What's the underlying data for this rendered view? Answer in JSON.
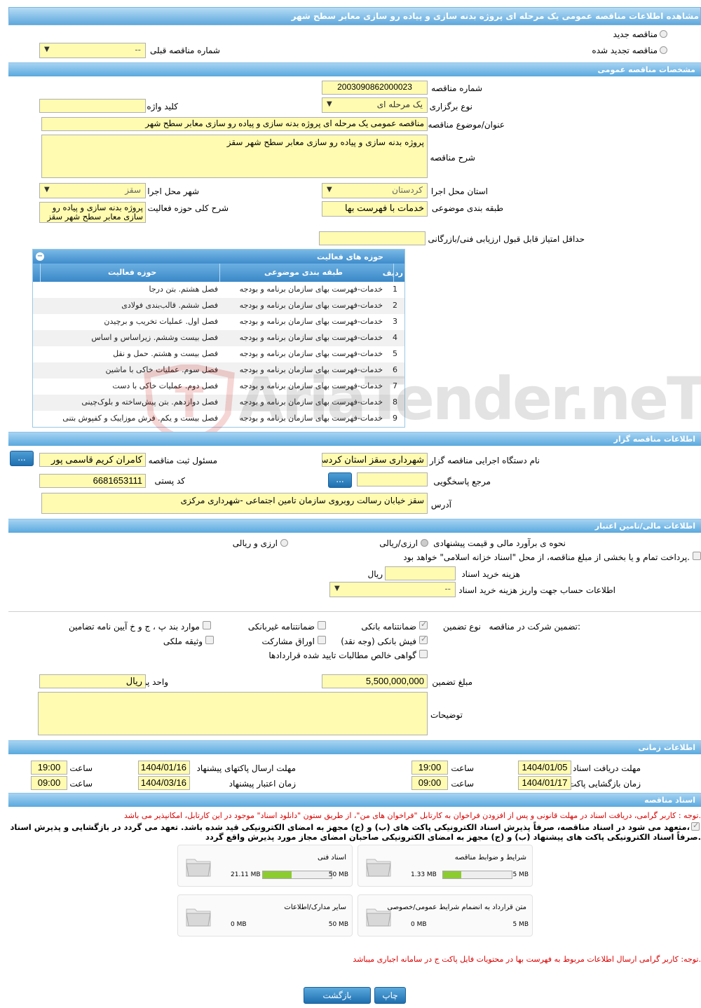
{
  "title": "مشاهده اطلاعات مناقصه عمومی یک مرحله ای پروژه بدنه سازی و پیاده رو سازی معابر سطح شهر",
  "top": {
    "new_tender": "مناقصه جدید",
    "renewed_tender": "مناقصه تجدید شده",
    "prev_number_label": "شماره مناقصه قبلی",
    "prev_number_value": "--"
  },
  "general": {
    "header": "مشخصات مناقصه عمومی",
    "number_label": "شماره مناقصه",
    "number_value": "2003090862000023",
    "type_label": "نوع برگزاری",
    "type_value": "یک مرحله ای",
    "keyword_label": "کلید واژه",
    "subject_label": "عنوان/موضوع مناقصه",
    "subject_value": "مناقصه عمومی یک مرحله ای  پروژه بدنه سازی و پیاده رو سازی معابر سطح شهر",
    "desc_label": "شرح مناقصه",
    "desc_value": "پروژه بدنه سازی و پیاده رو سازی معابر سطح شهر سقز",
    "province_label": "استان محل اجرا",
    "province_value": "کردستان",
    "city_label": "شهر محل اجرا",
    "city_value": "سقز",
    "category_label": "طبقه بندی موضوعی",
    "category_value": "خدمات با فهرست بها",
    "activity_label": "شرح کلی حوزه فعالیت",
    "activity_value": "پروژه بدنه سازی و پیاده رو سازی معابر سطح شهر سقز",
    "minscore_label": "حداقل امتیاز قابل قبول ارزیابی فنی/بازرگانی"
  },
  "activities": {
    "title": "حوزه های فعالیت",
    "col_row": "ردیف",
    "col_category": "طبقه بندی موضوعی",
    "col_activity": "حوزه فعالیت",
    "rows": [
      {
        "n": "1",
        "cat": "خدمات-فهرست بهای سازمان برنامه و بودجه",
        "act": "فصل هشتم. بتن درجا"
      },
      {
        "n": "2",
        "cat": "خدمات-فهرست بهای سازمان برنامه و بودجه",
        "act": "فصل ششم. قالب‌بندی فولادی"
      },
      {
        "n": "3",
        "cat": "خدمات-فهرست بهای سازمان برنامه و بودجه",
        "act": "فصل اول. عملیات تخریب و برچیدن"
      },
      {
        "n": "4",
        "cat": "خدمات-فهرست بهای سازمان برنامه و بودجه",
        "act": "فصل بیست وششم. زیراساس و اساس"
      },
      {
        "n": "5",
        "cat": "خدمات-فهرست بهای سازمان برنامه و بودجه",
        "act": "فصل بیست و هشتم. حمل و نقل"
      },
      {
        "n": "6",
        "cat": "خدمات-فهرست بهای سازمان برنامه و بودجه",
        "act": "فصل سوم. عملیات خاکی با ماشین"
      },
      {
        "n": "7",
        "cat": "خدمات-فهرست بهای سازمان برنامه و بودجه",
        "act": "فصل دوم. عملیات خاکی با دست"
      },
      {
        "n": "8",
        "cat": "خدمات-فهرست بهای سازمان برنامه و بودجه",
        "act": "فصل دوازدهم. بتن پیش‌ساخته و بلوک‌چینی"
      },
      {
        "n": "9",
        "cat": "خدمات-فهرست بهای سازمان برنامه و بودجه",
        "act": "فصل بیست و یکم. فرش موزاییک و کفپوش بتنی"
      }
    ]
  },
  "watermark": "AriaTender.neT",
  "organizer": {
    "header": "اطلاعات مناقصه گزار",
    "org_label": "نام دستگاه اجرایی مناقصه گزار",
    "org_value": "شهرداری سقز استان کردستان",
    "resp_label": "مسئول ثبت مناقصه",
    "resp_value": "کامران کریم قاسمی پور",
    "ref_label": "مرجع پاسخگویی",
    "postal_label": "کد پستی",
    "postal_value": "6681653111",
    "address_label": "آدرس",
    "address_value": "سقز خیابان رسالت روبروی سازمان تامین اجتماعی -شهرداری مرکزی",
    "more_btn": "..."
  },
  "finance": {
    "header": "اطلاعات مالی/تامین اعتبار",
    "method_label": "نحوه ی برآورد مالی و قیمت پیشنهادی",
    "opt1": "ارزی/ریالی",
    "opt2": "ارزی و ریالی",
    "payment_note": "پرداخت تمام و یا بخشی از مبلغ مناقصه، از محل \"اسناد خزانه اسلامی\" خواهد بود.",
    "doc_cost_label": "هزینه خرید اسناد",
    "doc_cost_unit": "ریال",
    "account_label": "اطلاعات حساب جهت واریز هزینه خرید اسناد",
    "account_value": "--"
  },
  "guarantee": {
    "participation_label": "تضمین شرکت در مناقصه:",
    "type_label": "نوع تضمین",
    "bank": "ضمانتنامه بانکی",
    "nonbank": "ضمانتنامه غیربانکی",
    "clauses": "موارد بند پ ، ج و خ آیین نامه تضامین",
    "cash": "فیش بانکی (وجه نقد)",
    "bonds": "اوراق مشارکت",
    "property": "وثیقه ملکی",
    "claims": "گواهی خالص مطالبات تایید شده قراردادها",
    "amount_label": "مبلغ تضمین",
    "amount_value": "5,500,000,000",
    "currency_label": "واحد پول",
    "currency_value": "ریال",
    "notes_label": "توضیحات"
  },
  "timing": {
    "header": "اطلاعات زمانی",
    "receive_label": "مهلت دریافت اسناد",
    "receive_date": "1404/01/05",
    "receive_time": "19:00",
    "send_label": "مهلت ارسال پاکتهای پیشنهاد",
    "send_date": "1404/01/16",
    "send_time": "19:00",
    "open_label": "زمان بازگشایی پاکت ها",
    "open_date": "1404/01/17",
    "open_time": "09:00",
    "valid_label": "زمان اعتبار پیشنهاد",
    "valid_date": "1404/03/16",
    "valid_time": "09:00",
    "time_label": "ساعت"
  },
  "docs": {
    "header": "اسناد مناقصه",
    "note1": "توجه : کاربر گرامی، دریافت اسناد در مهلت قانونی و پس از افزودن فراخوان به کارتابل \"فراخوان های من\"، از طریق ستون \"دانلود اسناد\" موجود در این کارتابل، امکانپذیر می باشد.",
    "commit1": "متعهد می شود در اسناد مناقصه، صرفاً پذیرش اسناد الکترونیکی پاکت های (ب) و (ج) مجهز به امضای الکترونیکی قید شده باشد. تعهد می گردد در بازگشایی و پذیرش اسناد،",
    "commit2": "صرفاً اسناد الکترونیکی پاکت های پیشنهاد (ب) و (ج) مجهز به امضای الکترونیکی صاحبان امضای مجاز مورد پذیرش واقع گردد.",
    "files": [
      {
        "name": "شرایط و ضوابط مناقصه",
        "used": "1.33 MB",
        "max": "5 MB",
        "fill": 0.27
      },
      {
        "name": "اسناد فنی",
        "used": "21.11 MB",
        "max": "50 MB",
        "fill": 0.42
      },
      {
        "name": "متن قرارداد به انضمام شرایط عمومی/خصوصی",
        "used": "0 MB",
        "max": "5 MB",
        "fill": 0
      },
      {
        "name": "سایر مدارک/اطلاعات",
        "used": "0 MB",
        "max": "50 MB",
        "fill": 0
      }
    ],
    "note2": "توجه: کاربر گرامی ارسال اطلاعات مربوط به فهرست بها در محتویات فایل پاکت ج در سامانه اجباری میباشد."
  },
  "buttons": {
    "print": "چاپ",
    "back": "بازگشت"
  },
  "colors": {
    "bar": "#5aa9de",
    "field": "#fffbb0",
    "note": "#dd0000",
    "progress": "#8ccc30"
  }
}
